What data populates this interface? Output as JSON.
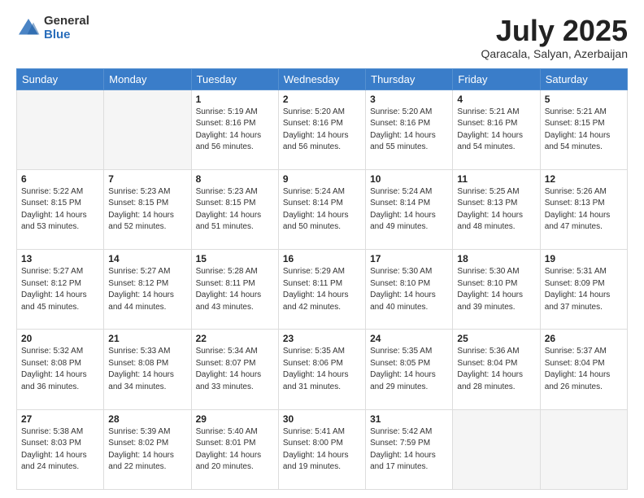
{
  "header": {
    "logo_general": "General",
    "logo_blue": "Blue",
    "month_title": "July 2025",
    "location": "Qaracala, Salyan, Azerbaijan"
  },
  "weekdays": [
    "Sunday",
    "Monday",
    "Tuesday",
    "Wednesday",
    "Thursday",
    "Friday",
    "Saturday"
  ],
  "weeks": [
    [
      {
        "day": "",
        "empty": true
      },
      {
        "day": "",
        "empty": true
      },
      {
        "day": "1",
        "sunrise": "5:19 AM",
        "sunset": "8:16 PM",
        "daylight": "14 hours and 56 minutes."
      },
      {
        "day": "2",
        "sunrise": "5:20 AM",
        "sunset": "8:16 PM",
        "daylight": "14 hours and 56 minutes."
      },
      {
        "day": "3",
        "sunrise": "5:20 AM",
        "sunset": "8:16 PM",
        "daylight": "14 hours and 55 minutes."
      },
      {
        "day": "4",
        "sunrise": "5:21 AM",
        "sunset": "8:16 PM",
        "daylight": "14 hours and 54 minutes."
      },
      {
        "day": "5",
        "sunrise": "5:21 AM",
        "sunset": "8:15 PM",
        "daylight": "14 hours and 54 minutes."
      }
    ],
    [
      {
        "day": "6",
        "sunrise": "5:22 AM",
        "sunset": "8:15 PM",
        "daylight": "14 hours and 53 minutes."
      },
      {
        "day": "7",
        "sunrise": "5:23 AM",
        "sunset": "8:15 PM",
        "daylight": "14 hours and 52 minutes."
      },
      {
        "day": "8",
        "sunrise": "5:23 AM",
        "sunset": "8:15 PM",
        "daylight": "14 hours and 51 minutes."
      },
      {
        "day": "9",
        "sunrise": "5:24 AM",
        "sunset": "8:14 PM",
        "daylight": "14 hours and 50 minutes."
      },
      {
        "day": "10",
        "sunrise": "5:24 AM",
        "sunset": "8:14 PM",
        "daylight": "14 hours and 49 minutes."
      },
      {
        "day": "11",
        "sunrise": "5:25 AM",
        "sunset": "8:13 PM",
        "daylight": "14 hours and 48 minutes."
      },
      {
        "day": "12",
        "sunrise": "5:26 AM",
        "sunset": "8:13 PM",
        "daylight": "14 hours and 47 minutes."
      }
    ],
    [
      {
        "day": "13",
        "sunrise": "5:27 AM",
        "sunset": "8:12 PM",
        "daylight": "14 hours and 45 minutes."
      },
      {
        "day": "14",
        "sunrise": "5:27 AM",
        "sunset": "8:12 PM",
        "daylight": "14 hours and 44 minutes."
      },
      {
        "day": "15",
        "sunrise": "5:28 AM",
        "sunset": "8:11 PM",
        "daylight": "14 hours and 43 minutes."
      },
      {
        "day": "16",
        "sunrise": "5:29 AM",
        "sunset": "8:11 PM",
        "daylight": "14 hours and 42 minutes."
      },
      {
        "day": "17",
        "sunrise": "5:30 AM",
        "sunset": "8:10 PM",
        "daylight": "14 hours and 40 minutes."
      },
      {
        "day": "18",
        "sunrise": "5:30 AM",
        "sunset": "8:10 PM",
        "daylight": "14 hours and 39 minutes."
      },
      {
        "day": "19",
        "sunrise": "5:31 AM",
        "sunset": "8:09 PM",
        "daylight": "14 hours and 37 minutes."
      }
    ],
    [
      {
        "day": "20",
        "sunrise": "5:32 AM",
        "sunset": "8:08 PM",
        "daylight": "14 hours and 36 minutes."
      },
      {
        "day": "21",
        "sunrise": "5:33 AM",
        "sunset": "8:08 PM",
        "daylight": "14 hours and 34 minutes."
      },
      {
        "day": "22",
        "sunrise": "5:34 AM",
        "sunset": "8:07 PM",
        "daylight": "14 hours and 33 minutes."
      },
      {
        "day": "23",
        "sunrise": "5:35 AM",
        "sunset": "8:06 PM",
        "daylight": "14 hours and 31 minutes."
      },
      {
        "day": "24",
        "sunrise": "5:35 AM",
        "sunset": "8:05 PM",
        "daylight": "14 hours and 29 minutes."
      },
      {
        "day": "25",
        "sunrise": "5:36 AM",
        "sunset": "8:04 PM",
        "daylight": "14 hours and 28 minutes."
      },
      {
        "day": "26",
        "sunrise": "5:37 AM",
        "sunset": "8:04 PM",
        "daylight": "14 hours and 26 minutes."
      }
    ],
    [
      {
        "day": "27",
        "sunrise": "5:38 AM",
        "sunset": "8:03 PM",
        "daylight": "14 hours and 24 minutes."
      },
      {
        "day": "28",
        "sunrise": "5:39 AM",
        "sunset": "8:02 PM",
        "daylight": "14 hours and 22 minutes."
      },
      {
        "day": "29",
        "sunrise": "5:40 AM",
        "sunset": "8:01 PM",
        "daylight": "14 hours and 20 minutes."
      },
      {
        "day": "30",
        "sunrise": "5:41 AM",
        "sunset": "8:00 PM",
        "daylight": "14 hours and 19 minutes."
      },
      {
        "day": "31",
        "sunrise": "5:42 AM",
        "sunset": "7:59 PM",
        "daylight": "14 hours and 17 minutes."
      },
      {
        "day": "",
        "empty": true
      },
      {
        "day": "",
        "empty": true
      }
    ]
  ]
}
